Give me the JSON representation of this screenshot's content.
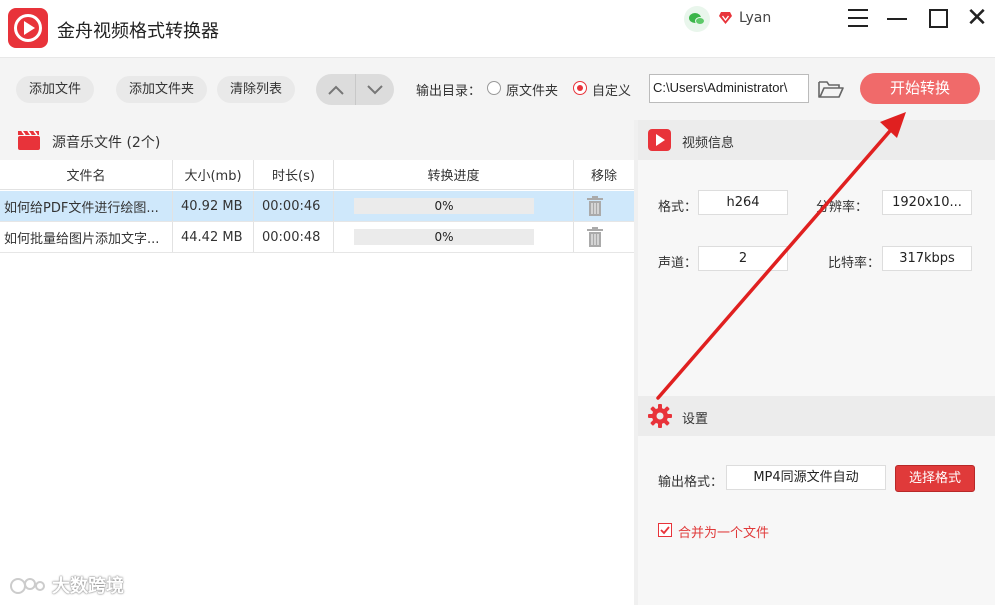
{
  "app": {
    "title": "金舟视频格式转换器",
    "user_name": "Lyan",
    "accent_color": "#e8333a"
  },
  "toolbar": {
    "add_file": "添加文件",
    "add_folder": "添加文件夹",
    "clear_list": "清除列表",
    "output_dir_label": "输出目录：",
    "radio_source": "原文件夹",
    "radio_custom": "自定义",
    "selected_output": "自定义",
    "output_path": "C:\\Users\\Administrator\\",
    "start": "开始转换"
  },
  "file_panel": {
    "title": "源音乐文件 (2个)",
    "columns": [
      "文件名",
      "大小(mb)",
      "时长(s)",
      "转换进度",
      "移除"
    ],
    "rows": [
      {
        "name": "如何给PDF文件进行绘图...",
        "size": "40.92 MB",
        "duration": "00:00:46",
        "progress": "0%",
        "progress_value": 0,
        "selected": true
      },
      {
        "name": "如何批量给图片添加文字...",
        "size": "44.42 MB",
        "duration": "00:00:48",
        "progress": "0%",
        "progress_value": 0,
        "selected": false
      }
    ]
  },
  "video_info": {
    "title": "视频信息",
    "format_label": "格式：",
    "format_value": "h264",
    "resolution_label": "分辨率：",
    "resolution_value": "1920x10...",
    "channels_label": "声道：",
    "channels_value": "2",
    "bitrate_label": "比特率：",
    "bitrate_value": "317kbps"
  },
  "settings": {
    "title": "设置",
    "output_format_label": "输出格式：",
    "output_format_value": "MP4同源文件自动",
    "select_format": "选择格式",
    "merge_label": "合并为一个文件",
    "merge_checked": true
  },
  "watermark": {
    "text": "大数跨境"
  }
}
